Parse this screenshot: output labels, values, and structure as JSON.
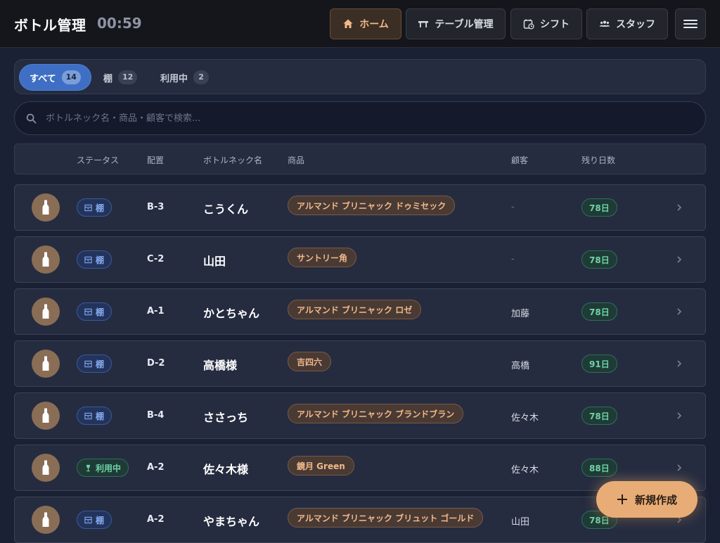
{
  "header": {
    "title": "ボトル管理",
    "clock": "00:59",
    "nav": {
      "home": "ホーム",
      "table": "テーブル管理",
      "shift": "シフト",
      "staff": "スタッフ"
    }
  },
  "filters": [
    {
      "label": "すべて",
      "count": "14",
      "active": true
    },
    {
      "label": "棚",
      "count": "12",
      "active": false
    },
    {
      "label": "利用中",
      "count": "2",
      "active": false
    }
  ],
  "search": {
    "placeholder": "ボトルネック名・商品・顧客で検索...",
    "value": ""
  },
  "columns": {
    "status": "ステータス",
    "location": "配置",
    "neck": "ボトルネック名",
    "product": "商品",
    "customer": "顧客",
    "days": "残り日数"
  },
  "rows": [
    {
      "status": "棚",
      "status_type": "shelf",
      "location": "B-3",
      "neck": "こうくん",
      "product": "アルマンド ブリニャック ドゥミセック",
      "customer": "-",
      "days": "78日"
    },
    {
      "status": "棚",
      "status_type": "shelf",
      "location": "C-2",
      "neck": "山田",
      "product": "サントリー角",
      "customer": "-",
      "days": "78日"
    },
    {
      "status": "棚",
      "status_type": "shelf",
      "location": "A-1",
      "neck": "かとちゃん",
      "product": "アルマンド ブリニャック ロゼ",
      "customer": "加藤",
      "days": "78日"
    },
    {
      "status": "棚",
      "status_type": "shelf",
      "location": "D-2",
      "neck": "高橋様",
      "product": "吉四六",
      "customer": "高橋",
      "days": "91日"
    },
    {
      "status": "棚",
      "status_type": "shelf",
      "location": "B-4",
      "neck": "ささっち",
      "product": "アルマンド ブリニャック ブランドブラン",
      "customer": "佐々木",
      "days": "78日"
    },
    {
      "status": "利用中",
      "status_type": "inuse",
      "location": "A-2",
      "neck": "佐々木様",
      "product": "鏡月 Green",
      "customer": "佐々木",
      "days": "88日"
    },
    {
      "status": "棚",
      "status_type": "shelf",
      "location": "A-2",
      "neck": "やまちゃん",
      "product": "アルマンド ブリニャック ブリュット ゴールド",
      "customer": "山田",
      "days": "78日"
    }
  ],
  "fab": {
    "label": "新規作成"
  }
}
